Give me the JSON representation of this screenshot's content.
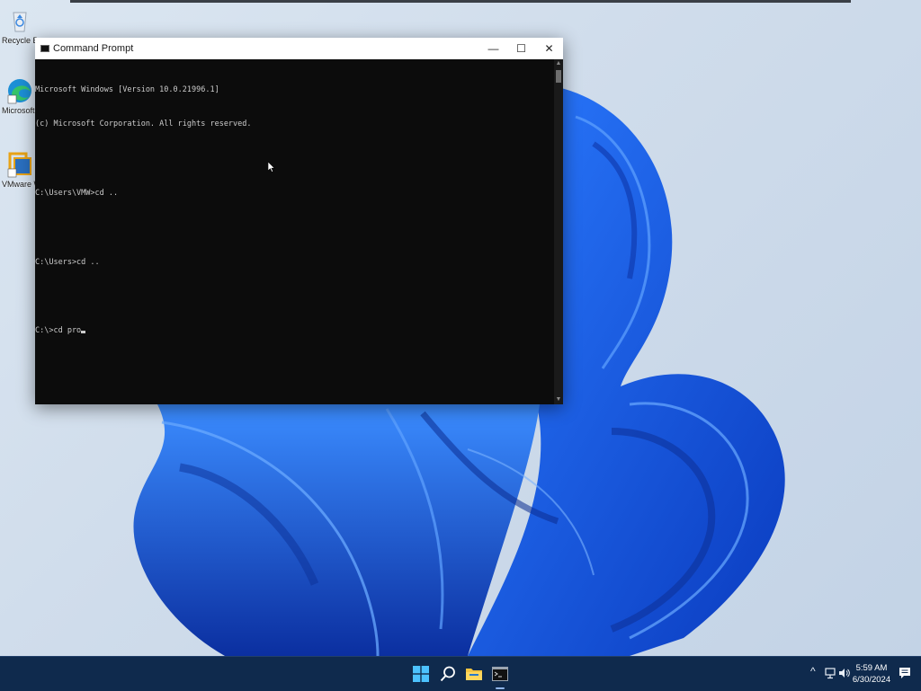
{
  "desktop": {
    "icons": [
      {
        "label": "Recycle Bin",
        "icon": "recycle-bin-icon"
      },
      {
        "label": "Microsoft Edge",
        "icon": "edge-icon"
      },
      {
        "label": "VMware Workstation",
        "icon": "vmware-icon"
      }
    ]
  },
  "cmd_window": {
    "title": "Command Prompt",
    "minimize": "—",
    "maximize": "☐",
    "close": "✕",
    "lines": [
      "Microsoft Windows [Version 10.0.21996.1]",
      "(c) Microsoft Corporation. All rights reserved.",
      "",
      "C:\\Users\\VMW>cd ..",
      "",
      "C:\\Users>cd ..",
      "",
      "C:\\>cd pro"
    ]
  },
  "taskbar": {
    "icons": [
      "windows-start-icon",
      "search-icon",
      "file-explorer-icon",
      "command-prompt-icon"
    ],
    "tray": {
      "chevron": "^",
      "network": "network-icon",
      "volume": "volume-icon"
    },
    "clock": {
      "time": "5:59 AM",
      "date": "6/30/2024"
    },
    "notification_icon": "notification-icon"
  },
  "colors": {
    "taskbar": "#0f2a4d",
    "console_bg": "#0c0c0c",
    "console_text": "#cccccc",
    "bloom_blue": "#1457e0"
  }
}
